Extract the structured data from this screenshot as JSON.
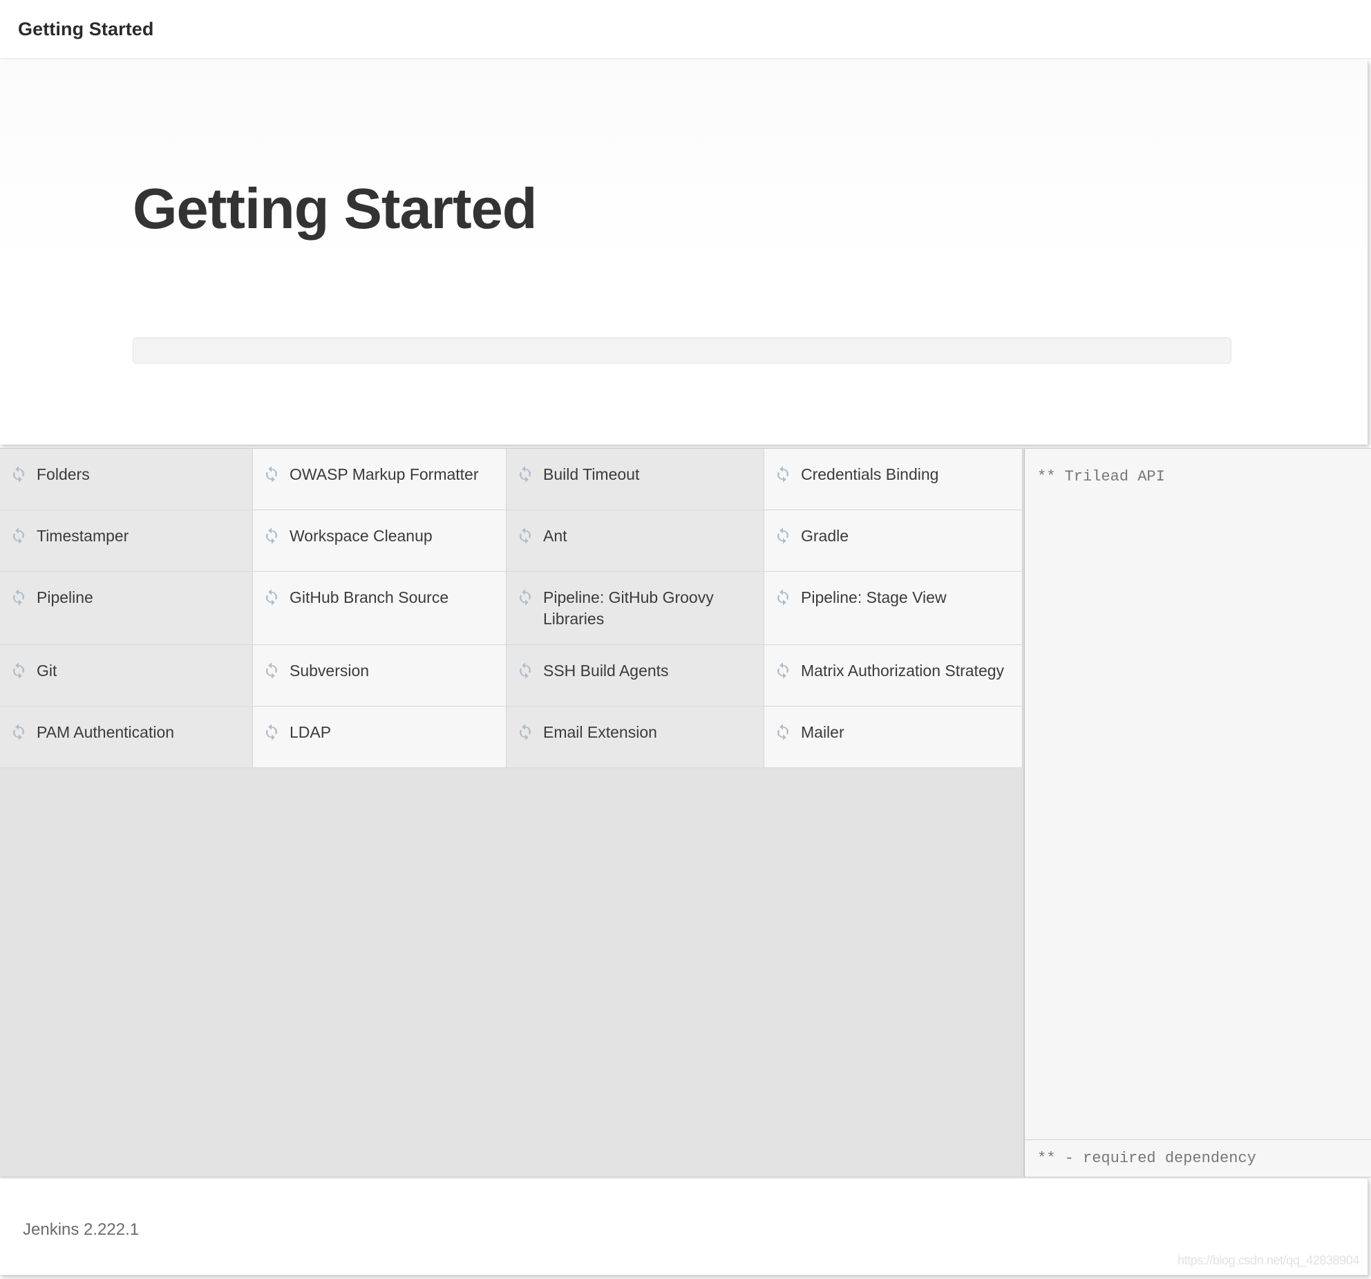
{
  "window": {
    "title": "Getting Started"
  },
  "hero": {
    "heading": "Getting Started",
    "progress_percent": 0
  },
  "plugins": {
    "icon_name": "sync-icon",
    "columns": 4,
    "items": [
      "Folders",
      "OWASP Markup Formatter",
      "Build Timeout",
      "Credentials Binding",
      "Timestamper",
      "Workspace Cleanup",
      "Ant",
      "Gradle",
      "Pipeline",
      "GitHub Branch Source",
      "Pipeline: GitHub Groovy Libraries",
      "Pipeline: Stage View",
      "Git",
      "Subversion",
      "SSH Build Agents",
      "Matrix Authorization Strategy",
      "PAM Authentication",
      "LDAP",
      "Email Extension",
      "Mailer"
    ]
  },
  "dependency_panel": {
    "log_lines": [
      "** Trilead API"
    ],
    "footnote": "** - required dependency"
  },
  "footer": {
    "version": "Jenkins 2.222.1",
    "watermark": "https://blog.csdn.net/qq_42838904"
  },
  "colors": {
    "cell_even_bg": "#e8e8e8",
    "cell_odd_bg": "#f7f7f7",
    "panel_bg": "#f6f6f6",
    "grid_bg": "#e3e3e3",
    "icon": "#aebdcc",
    "text": "#3b3b3b",
    "muted_text": "#777777"
  }
}
